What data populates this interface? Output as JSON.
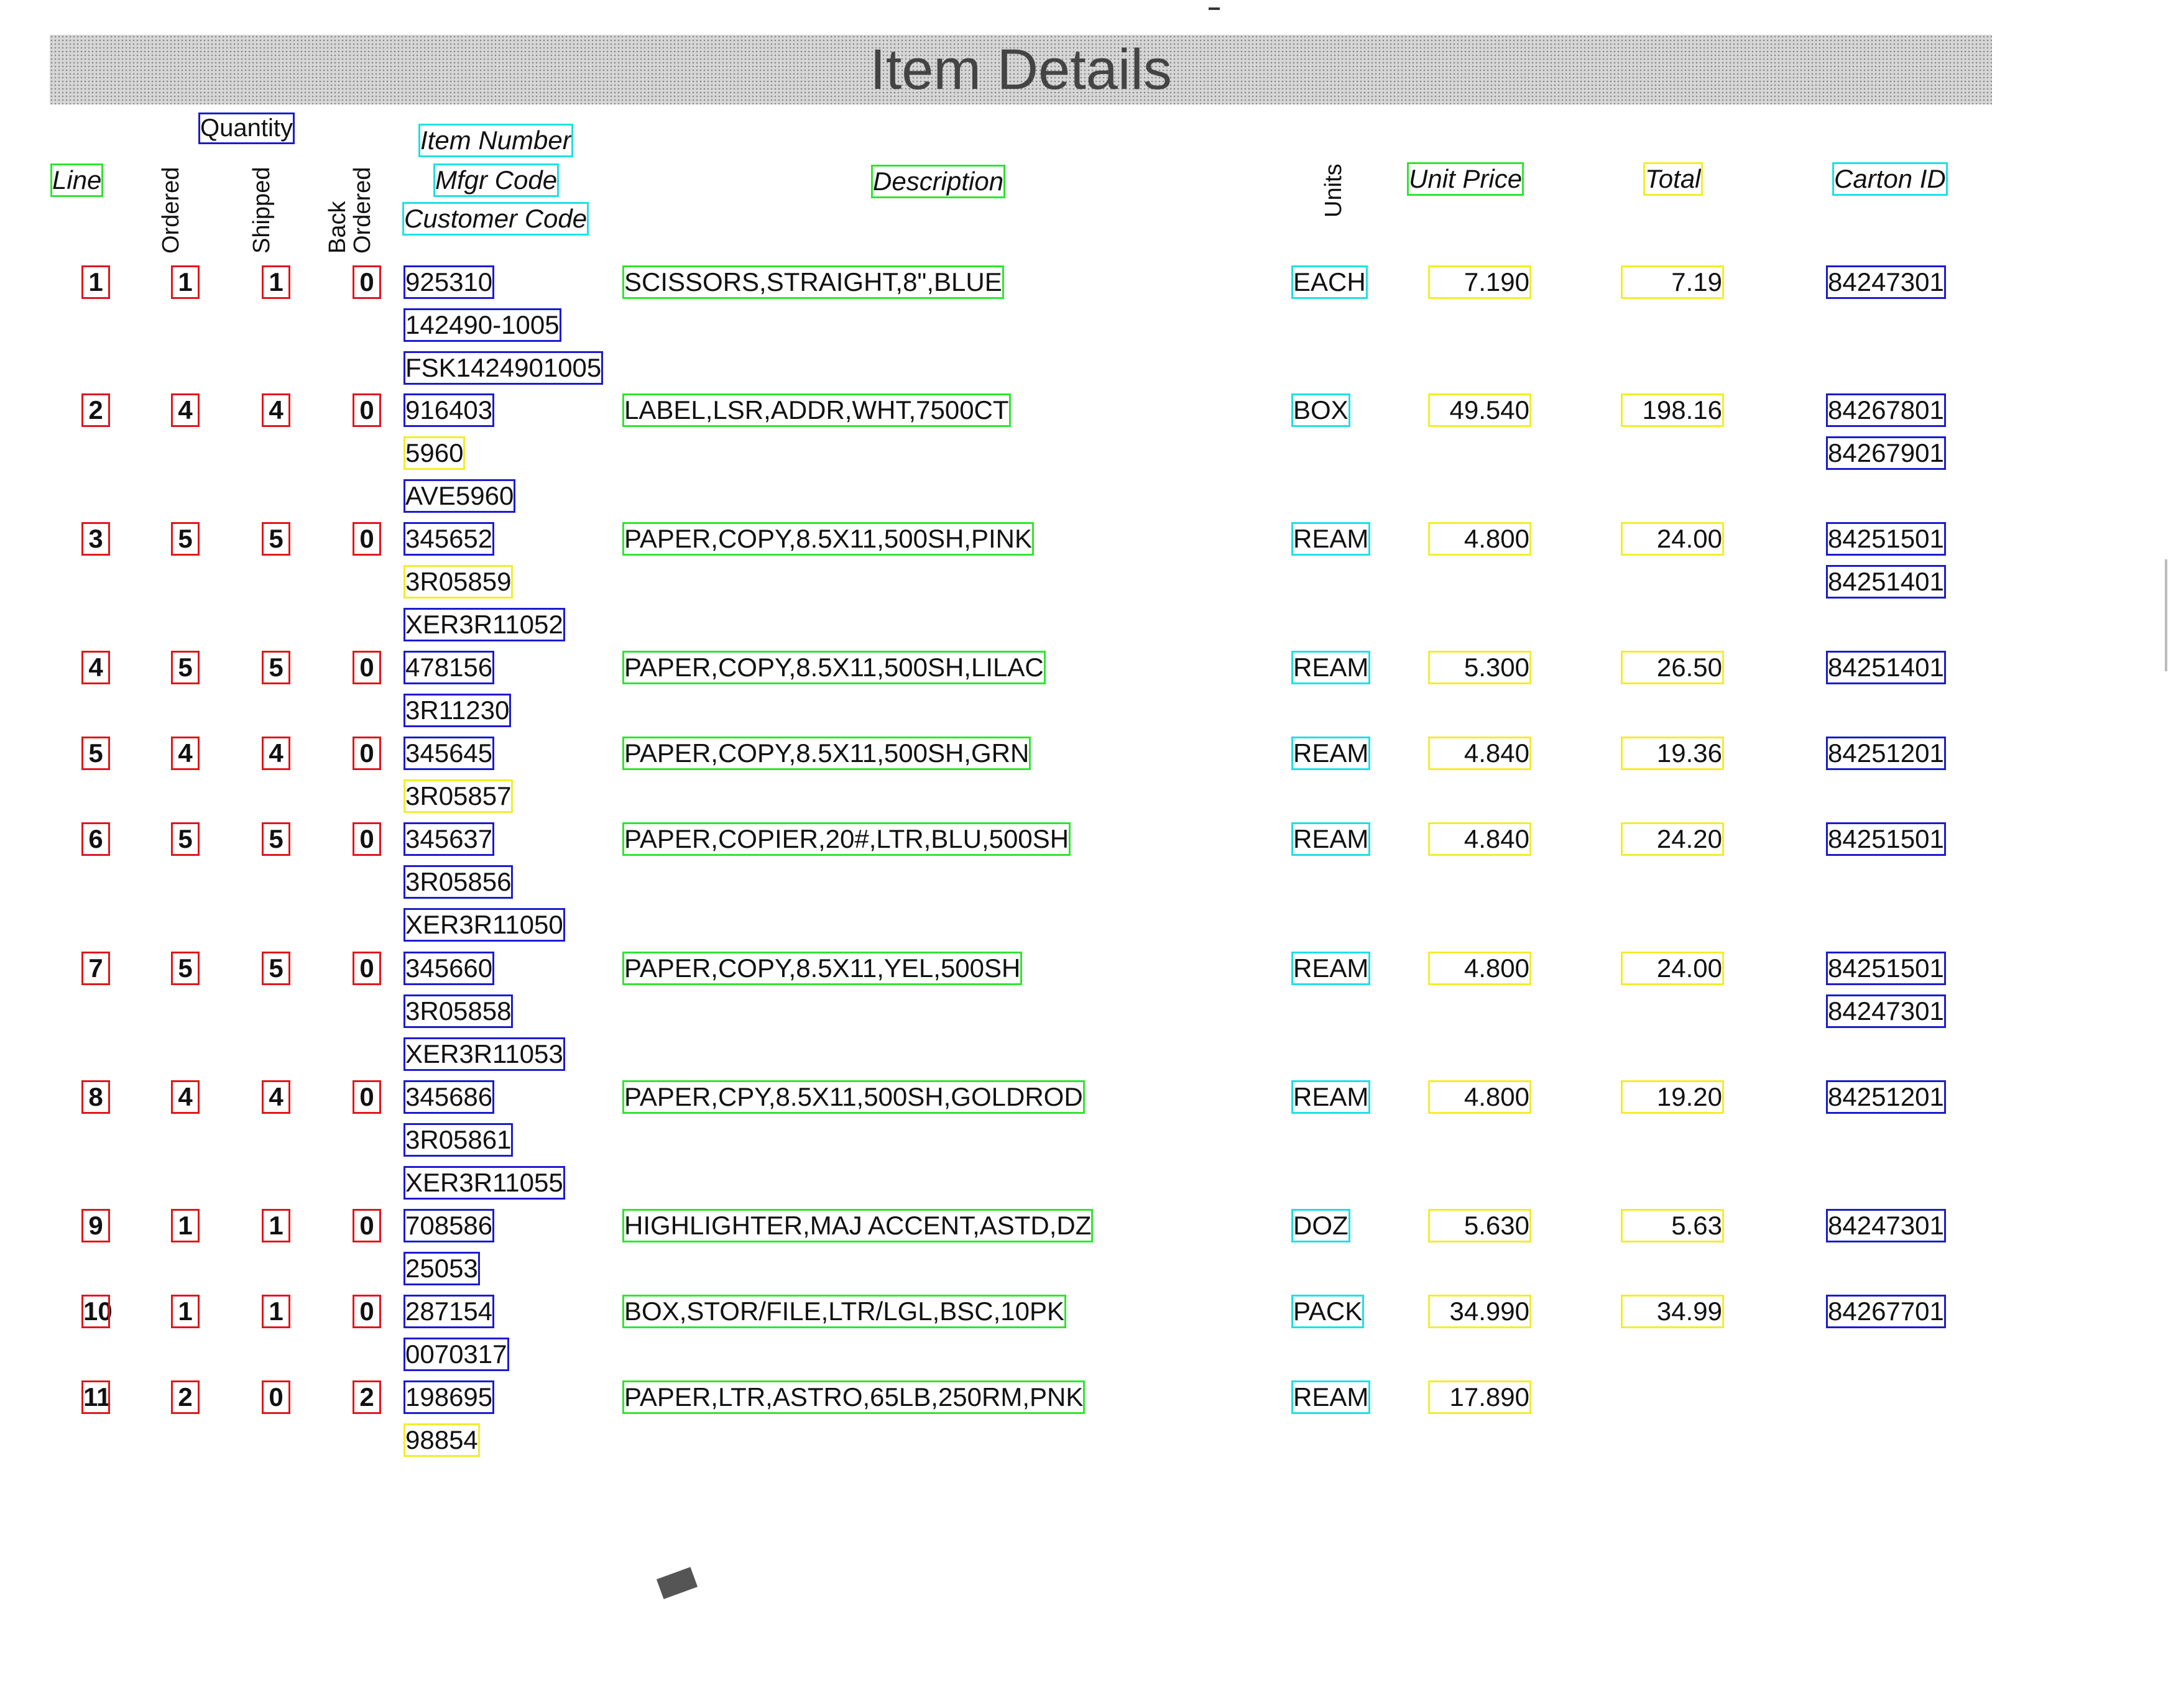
{
  "title": "Item Details",
  "headers": {
    "line": "Line",
    "quantity": "Quantity",
    "ordered": "Ordered",
    "shipped": "Shipped",
    "back": "Back",
    "back_ordered": "Ordered",
    "item_number": "Item Number",
    "mfgr_code": "Mfgr Code",
    "customer_code": "Customer Code",
    "description": "Description",
    "units": "Units",
    "unit_price": "Unit Price",
    "total": "Total",
    "carton_id": "Carton ID"
  },
  "rows": [
    {
      "line": "1",
      "ordered": "1",
      "shipped": "1",
      "back": "0",
      "codes": [
        "925310",
        "142490-1005",
        "FSK1424901005"
      ],
      "description": "SCISSORS,STRAIGHT,8\",BLUE",
      "units": "EACH",
      "unit_price": "7.190",
      "total": "7.19",
      "cartons": [
        "84247301"
      ]
    },
    {
      "line": "2",
      "ordered": "4",
      "shipped": "4",
      "back": "0",
      "codes": [
        "916403",
        "5960",
        "AVE5960"
      ],
      "description": "LABEL,LSR,ADDR,WHT,7500CT",
      "units": "BOX",
      "unit_price": "49.540",
      "total": "198.16",
      "cartons": [
        "84267801",
        "84267901"
      ]
    },
    {
      "line": "3",
      "ordered": "5",
      "shipped": "5",
      "back": "0",
      "codes": [
        "345652",
        "3R05859",
        "XER3R11052"
      ],
      "description": "PAPER,COPY,8.5X11,500SH,PINK",
      "units": "REAM",
      "unit_price": "4.800",
      "total": "24.00",
      "cartons": [
        "84251501",
        "84251401"
      ]
    },
    {
      "line": "4",
      "ordered": "5",
      "shipped": "5",
      "back": "0",
      "codes": [
        "478156",
        "3R11230"
      ],
      "description": "PAPER,COPY,8.5X11,500SH,LILAC",
      "units": "REAM",
      "unit_price": "5.300",
      "total": "26.50",
      "cartons": [
        "84251401"
      ]
    },
    {
      "line": "5",
      "ordered": "4",
      "shipped": "4",
      "back": "0",
      "codes": [
        "345645",
        "3R05857"
      ],
      "description": "PAPER,COPY,8.5X11,500SH,GRN",
      "units": "REAM",
      "unit_price": "4.840",
      "total": "19.36",
      "cartons": [
        "84251201"
      ]
    },
    {
      "line": "6",
      "ordered": "5",
      "shipped": "5",
      "back": "0",
      "codes": [
        "345637",
        "3R05856",
        "XER3R11050"
      ],
      "description": "PAPER,COPIER,20#,LTR,BLU,500SH",
      "units": "REAM",
      "unit_price": "4.840",
      "total": "24.20",
      "cartons": [
        "84251501"
      ]
    },
    {
      "line": "7",
      "ordered": "5",
      "shipped": "5",
      "back": "0",
      "codes": [
        "345660",
        "3R05858",
        "XER3R11053"
      ],
      "description": "PAPER,COPY,8.5X11,YEL,500SH",
      "units": "REAM",
      "unit_price": "4.800",
      "total": "24.00",
      "cartons": [
        "84251501",
        "84247301"
      ]
    },
    {
      "line": "8",
      "ordered": "4",
      "shipped": "4",
      "back": "0",
      "codes": [
        "345686",
        "3R05861",
        "XER3R11055"
      ],
      "description": "PAPER,CPY,8.5X11,500SH,GOLDROD",
      "units": "REAM",
      "unit_price": "4.800",
      "total": "19.20",
      "cartons": [
        "84251201"
      ]
    },
    {
      "line": "9",
      "ordered": "1",
      "shipped": "1",
      "back": "0",
      "codes": [
        "708586",
        "25053"
      ],
      "description": "HIGHLIGHTER,MAJ ACCENT,ASTD,DZ",
      "units": "DOZ",
      "unit_price": "5.630",
      "total": "5.63",
      "cartons": [
        "84247301"
      ]
    },
    {
      "line": "10",
      "ordered": "1",
      "shipped": "1",
      "back": "0",
      "codes": [
        "287154",
        "0070317"
      ],
      "description": "BOX,STOR/FILE,LTR/LGL,BSC,10PK",
      "units": "PACK",
      "unit_price": "34.990",
      "total": "34.99",
      "cartons": [
        "84267701"
      ]
    },
    {
      "line": "11",
      "ordered": "2",
      "shipped": "0",
      "back": "2",
      "codes": [
        "198695",
        "98854"
      ],
      "description": "PAPER,LTR,ASTRO,65LB,250RM,PNK",
      "units": "REAM",
      "unit_price": "17.890",
      "total": "",
      "cartons": []
    }
  ],
  "colors": {
    "red": "#e0161c",
    "green": "#2ee62e",
    "cyan": "#1fe0e6",
    "blue": "#1b1bd0",
    "yellow": "#f2ee2a"
  }
}
